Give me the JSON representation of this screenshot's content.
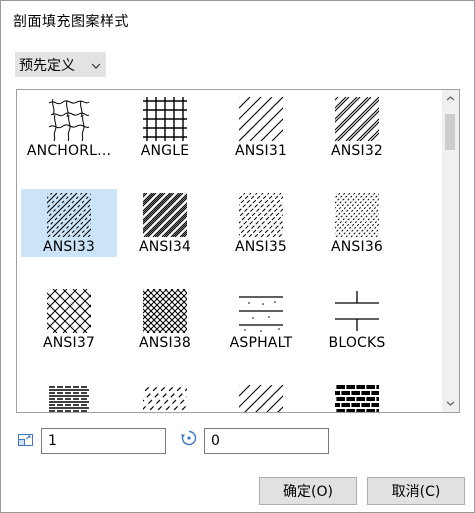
{
  "dialog": {
    "title": "剖面填充图案样式",
    "preset_label": "预先定义",
    "chevron_icon": "chevron-down-icon"
  },
  "patterns": [
    {
      "name": "ANCHORL...",
      "pattern": "anchorlock"
    },
    {
      "name": "ANGLE",
      "pattern": "angle"
    },
    {
      "name": "ANSI31",
      "pattern": "ansi31"
    },
    {
      "name": "ANSI32",
      "pattern": "ansi32"
    },
    {
      "name": "ANSI33",
      "pattern": "ansi33",
      "selected": true
    },
    {
      "name": "ANSI34",
      "pattern": "ansi34"
    },
    {
      "name": "ANSI35",
      "pattern": "ansi35"
    },
    {
      "name": "ANSI36",
      "pattern": "ansi36"
    },
    {
      "name": "ANSI37",
      "pattern": "ansi37"
    },
    {
      "name": "ANSI38",
      "pattern": "ansi38"
    },
    {
      "name": "ASPHALT",
      "pattern": "asphalt"
    },
    {
      "name": "BLOCKS",
      "pattern": "blocks"
    },
    {
      "name": "",
      "pattern": "hlines"
    },
    {
      "name": "",
      "pattern": "dashdiag"
    },
    {
      "name": "",
      "pattern": "ansi31"
    },
    {
      "name": "",
      "pattern": "brick"
    }
  ],
  "scale": {
    "value": "1",
    "icon": "scale-icon"
  },
  "angle": {
    "value": "0",
    "icon": "rotate-icon"
  },
  "buttons": {
    "ok": "确定(O)",
    "cancel": "取消(C)"
  },
  "colors": {
    "selection": "#cce4f7",
    "preset_bg": "#e3e3e3"
  }
}
